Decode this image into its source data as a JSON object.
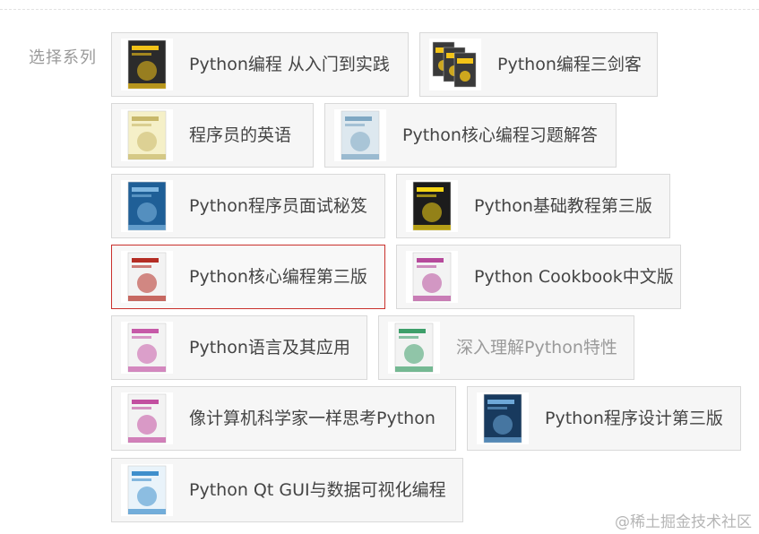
{
  "selector": {
    "label": "选择系列",
    "options": [
      {
        "label": "Python编程 从入门到实践",
        "icon": "book-cover-python-crash-course-icon",
        "selected": false,
        "disabled": false,
        "cover": "#2b2b2b",
        "accent": "#f2c318"
      },
      {
        "label": "Python编程三剑客",
        "icon": "book-set-cover-icon",
        "selected": false,
        "disabled": false,
        "cover": "#3a3a3a",
        "accent": "#f2c318"
      },
      {
        "label": "程序员的英语",
        "icon": "book-cover-programmer-english-icon",
        "selected": false,
        "disabled": false,
        "cover": "#f5f0c8",
        "accent": "#c8b86a"
      },
      {
        "label": "Python核心编程习题解答",
        "icon": "book-cover-core-python-answers-icon",
        "selected": false,
        "disabled": false,
        "cover": "#dde8ef",
        "accent": "#7ea7c3"
      },
      {
        "label": "Python程序员面试秘笈",
        "icon": "book-cover-python-interview-icon",
        "selected": false,
        "disabled": false,
        "cover": "#1f5f97",
        "accent": "#7fb6e0"
      },
      {
        "label": "Python基础教程第三版",
        "icon": "book-cover-beginning-python-icon",
        "selected": false,
        "disabled": false,
        "cover": "#1c1c1c",
        "accent": "#f5d515"
      },
      {
        "label": "Python核心编程第三版",
        "icon": "book-cover-core-python-3rd-icon",
        "selected": true,
        "disabled": false,
        "cover": "#f3f3f3",
        "accent": "#b42d24"
      },
      {
        "label": "Python Cookbook中文版",
        "icon": "book-cover-python-cookbook-icon",
        "selected": false,
        "disabled": false,
        "cover": "#f3f3f3",
        "accent": "#b64a9b"
      },
      {
        "label": "Python语言及其应用",
        "icon": "book-cover-introducing-python-icon",
        "selected": false,
        "disabled": false,
        "cover": "#f3f3f3",
        "accent": "#c65aa8"
      },
      {
        "label": "深入理解Python特性",
        "icon": "book-cover-python-tricks-icon",
        "selected": false,
        "disabled": true,
        "cover": "#f3f3f3",
        "accent": "#3e9f6a"
      },
      {
        "label": "像计算机科学家一样思考Python",
        "icon": "book-cover-think-python-icon",
        "selected": false,
        "disabled": false,
        "cover": "#f3f3f3",
        "accent": "#c24fa0"
      },
      {
        "label": "Python程序设计第三版",
        "icon": "book-cover-python-programming-icon",
        "selected": false,
        "disabled": false,
        "cover": "#183a5e",
        "accent": "#6ea8d8"
      },
      {
        "label": "Python Qt GUI与数据可视化编程",
        "icon": "book-cover-python-qt-gui-icon",
        "selected": false,
        "disabled": false,
        "cover": "#e9f3fa",
        "accent": "#3f8fcc"
      }
    ]
  },
  "watermark": "@稀土掘金技术社区",
  "colors": {
    "selected_border": "#c9302c",
    "option_bg": "#f6f6f6",
    "option_border": "#d9d9d9"
  }
}
